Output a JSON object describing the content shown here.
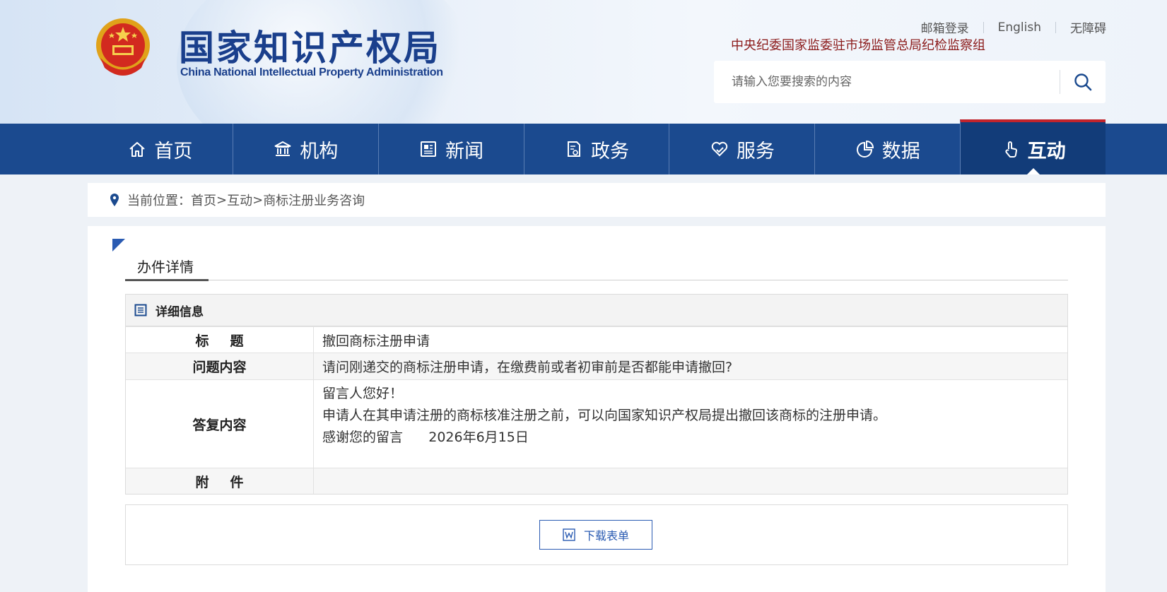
{
  "header": {
    "logo_cn": "国家知识产权局",
    "logo_en": "China National Intellectual Property Administration",
    "top_links": [
      "邮箱登录",
      "English",
      "无障碍"
    ],
    "discipline_text": "中央纪委国家监委驻市场监管总局纪检监察组",
    "search_placeholder": "请输入您要搜索的内容"
  },
  "nav": {
    "items": [
      {
        "label": "首页",
        "icon": "home-icon"
      },
      {
        "label": "机构",
        "icon": "institution-icon"
      },
      {
        "label": "新闻",
        "icon": "news-icon"
      },
      {
        "label": "政务",
        "icon": "government-affairs-icon"
      },
      {
        "label": "服务",
        "icon": "service-icon"
      },
      {
        "label": "数据",
        "icon": "data-pie-icon"
      },
      {
        "label": "互动",
        "icon": "interaction-hand-icon"
      }
    ],
    "active_index": 6
  },
  "breadcrumb": {
    "prefix": "当前位置：",
    "items": [
      "首页",
      "互动",
      "商标注册业务咨询"
    ],
    "separator": ">"
  },
  "section": {
    "title": "办件详情",
    "detail_header": "详细信息"
  },
  "detail": {
    "title_label": "标题",
    "title_value": "撤回商标注册申请",
    "question_label": "问题内容",
    "question_value": "请问刚递交的商标注册申请，在缴费前或者初审前是否都能申请撤回?",
    "answer_label": "答复内容",
    "answer_lines": [
      "留言人您好！",
      "申请人在其申请注册的商标核准注册之前，可以向国家知识产权局提出撤回该商标的注册申请。",
      "感谢您的留言      2026年6月15日"
    ],
    "attachment_label": "附件",
    "attachment_value": ""
  },
  "download": {
    "label": "下载表单",
    "icon": "word-doc-icon"
  },
  "colors": {
    "nav_bg": "#1b4a8f",
    "nav_active_bg": "#123c79",
    "accent_red": "#c2242c",
    "logo_blue": "#1a3f8c",
    "link_blue": "#2a5bb2",
    "discipline_red": "#8b1a1a"
  }
}
